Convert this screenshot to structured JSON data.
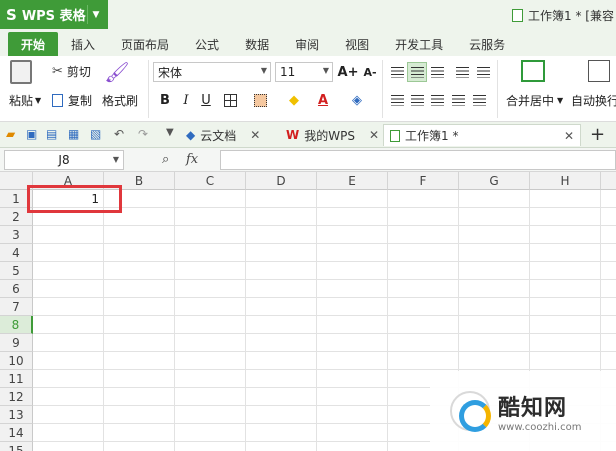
{
  "app": {
    "name": "WPS 表格",
    "logo_glyph": "S",
    "dropdown_glyph": "▼"
  },
  "window": {
    "title": "工作簿1 * [兼容"
  },
  "ribbon_tabs": [
    {
      "label": "开始",
      "active": true
    },
    {
      "label": "插入"
    },
    {
      "label": "页面布局"
    },
    {
      "label": "公式"
    },
    {
      "label": "数据"
    },
    {
      "label": "审阅"
    },
    {
      "label": "视图"
    },
    {
      "label": "开发工具"
    },
    {
      "label": "云服务"
    }
  ],
  "toolbar": {
    "paste_label": "粘贴",
    "cut_label": "剪切",
    "copy_label": "复制",
    "format_painter_label": "格式刷",
    "font_name": "宋体",
    "font_size": "11",
    "bold": "B",
    "italic": "I",
    "underline": "U",
    "grow_font": "A+",
    "shrink_font": "A-",
    "merge_center_label": "合并居中",
    "autowrap_label": "自动换行"
  },
  "doc_tabs": [
    {
      "label": "云文档"
    },
    {
      "label": "我的WPS"
    },
    {
      "label": "工作簿1 *",
      "active": true
    }
  ],
  "formula_bar": {
    "name_box": "J8",
    "fx_label": "fx",
    "formula": ""
  },
  "sheet": {
    "columns": [
      "A",
      "B",
      "C",
      "D",
      "E",
      "F",
      "G",
      "H"
    ],
    "rows": [
      "1",
      "2",
      "3",
      "4",
      "5",
      "6",
      "7",
      "8",
      "9",
      "10",
      "11",
      "12",
      "13",
      "14",
      "15"
    ],
    "selected_row": "8",
    "cells": {
      "A1": "1"
    }
  },
  "watermark": {
    "name": "酷知网",
    "url": "www.coozhi.com"
  },
  "colors": {
    "accent": "#3f9b38",
    "highlight_box": "#e0373c"
  }
}
